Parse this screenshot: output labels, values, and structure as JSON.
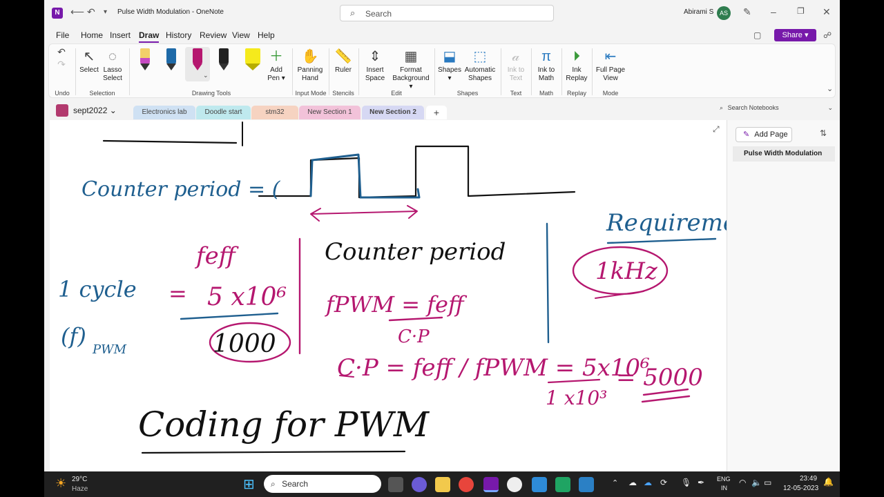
{
  "title_bar": {
    "app_title": "Pulse Width Modulation  -  OneNote",
    "search_placeholder": "Search",
    "user_name": "Abirami S",
    "user_initials": "AS"
  },
  "menu": {
    "items": [
      "File",
      "Home",
      "Insert",
      "Draw",
      "History",
      "Review",
      "View",
      "Help"
    ],
    "active": "Draw",
    "share_label": "Share"
  },
  "ribbon": {
    "undo_group": "Undo",
    "select": "Select",
    "lasso_select_1": "Lasso",
    "lasso_select_2": "Select",
    "selection_group": "Selection",
    "drawing_tools_group": "Drawing Tools",
    "add_pen_1": "Add",
    "add_pen_2": "Pen",
    "panning_hand_1": "Panning",
    "panning_hand_2": "Hand",
    "input_mode_group": "Input Mode",
    "ruler": "Ruler",
    "stencils_group": "Stencils",
    "insert_space_1": "Insert",
    "insert_space_2": "Space",
    "format_background_1": "Format",
    "format_background_2": "Background",
    "edit_group": "Edit",
    "shapes": "Shapes",
    "automatic_shapes_1": "Automatic",
    "automatic_shapes_2": "Shapes",
    "shapes_group": "Shapes",
    "ink_to_text_1": "Ink to",
    "ink_to_text_2": "Text",
    "text_group": "Text",
    "ink_to_math_1": "Ink to",
    "ink_to_math_2": "Math",
    "math_group": "Math",
    "ink_replay_1": "Ink",
    "ink_replay_2": "Replay",
    "replay_group": "Replay",
    "full_page_view_1": "Full Page",
    "full_page_view_2": "View",
    "mode_group": "Mode",
    "pen_colors": [
      "#f2cf6a",
      "#1e6aa8",
      "#b5176f",
      "#222222",
      "#f5ea1c"
    ]
  },
  "notebook": {
    "name": "sept2022",
    "sections": [
      {
        "label": "Electronics lab",
        "color": "#cfe1f3"
      },
      {
        "label": "Doodle start",
        "color": "#bfe9ee"
      },
      {
        "label": "stm32",
        "color": "#f6d3c1"
      },
      {
        "label": "New Section 1",
        "color": "#f2c2d9"
      },
      {
        "label": "New Section 2",
        "color": "#d6d8f3"
      }
    ],
    "add_section": "+",
    "search_notebooks_placeholder": "Search Notebooks"
  },
  "page_pane": {
    "add_page": "Add Page",
    "pages": [
      "Pulse Width Modulation"
    ]
  },
  "canvas_ink": {
    "counter_period_eq": "Counter period = (",
    "feff": "feff",
    "five_e6": "5 x10⁶",
    "one_thousand": "1000",
    "one_cycle": "1 cycle",
    "equals": "=",
    "f_pwm_label": "(f)",
    "pwm_sub": "PWM",
    "counter_period_title": "Counter period",
    "fpwm_eq": "fPWM = feff",
    "cp": "C·P",
    "cp_eq": "C·P = feff / fPWM = 5x10⁶",
    "one_e3": "1 x10³",
    "five_thousand": "= 5000",
    "requirement": "Requiremen",
    "one_khz": "1kHz",
    "coding_for_pwm": "Coding for PWM"
  },
  "taskbar": {
    "temp": "29°C",
    "weather": "Haze",
    "search": "Search",
    "lang_1": "ENG",
    "lang_2": "IN",
    "time": "23:49",
    "date": "12-05-2023"
  }
}
